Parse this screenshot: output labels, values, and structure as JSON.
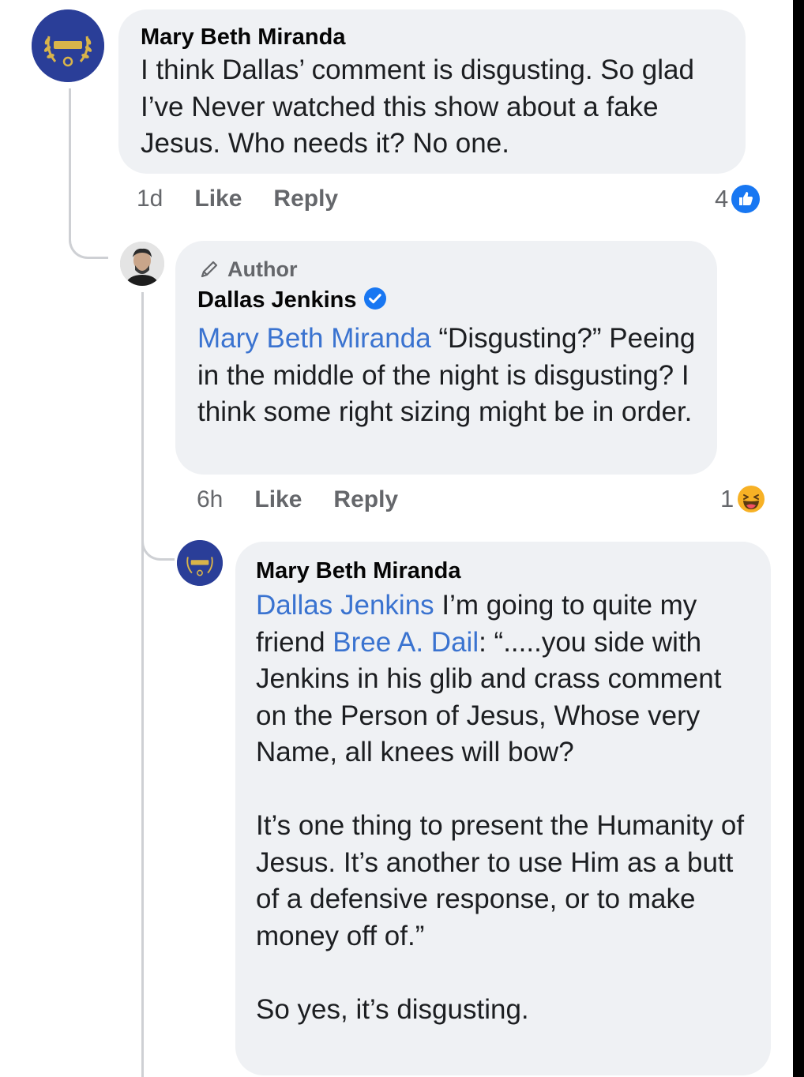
{
  "comment1": {
    "author": "Mary Beth Miranda",
    "text": "I think Dallas’ comment is disgusting. So glad I’ve Never watched this show about a fake Jesus. Who needs it?   No one.",
    "time": "1d",
    "like_label": "Like",
    "reply_label": "Reply",
    "reaction_count": "4",
    "reaction_icon": "like-icon",
    "avatar_icon": "laurel-seal-icon"
  },
  "reply1": {
    "badge": "Author",
    "author": "Dallas Jenkins",
    "verified": true,
    "mention": "Mary Beth Miranda",
    "text": " “Disgusting?” Peeing in the middle of the night is disgusting? I think some right sizing might be in order.",
    "time": "6h",
    "like_label": "Like",
    "reply_label": "Reply",
    "reaction_count": "1",
    "reaction_icon": "haha-icon",
    "avatar_icon": "profile-photo-icon"
  },
  "reply2": {
    "author": "Mary Beth Miranda",
    "mention": "Dallas Jenkins",
    "text_a": " I’m going to quite my friend ",
    "mention2": "Bree A. Dail",
    "text_b": ":  “.....you side with Jenkins in his glib and crass comment on the Person of Jesus, Whose very Name, all knees will bow?",
    "para2": "It’s one thing to present the Humanity of Jesus. It’s another to use Him as a butt of a defensive response, or to make money off of.”",
    "para3": "So yes, it’s disgusting.",
    "avatar_icon": "laurel-seal-icon"
  },
  "colors": {
    "bubble": "#eff1f4",
    "mention": "#3a73d0",
    "meta": "#65676b",
    "like_blue": "#1877f2",
    "seal_blue": "#2a3e98"
  }
}
